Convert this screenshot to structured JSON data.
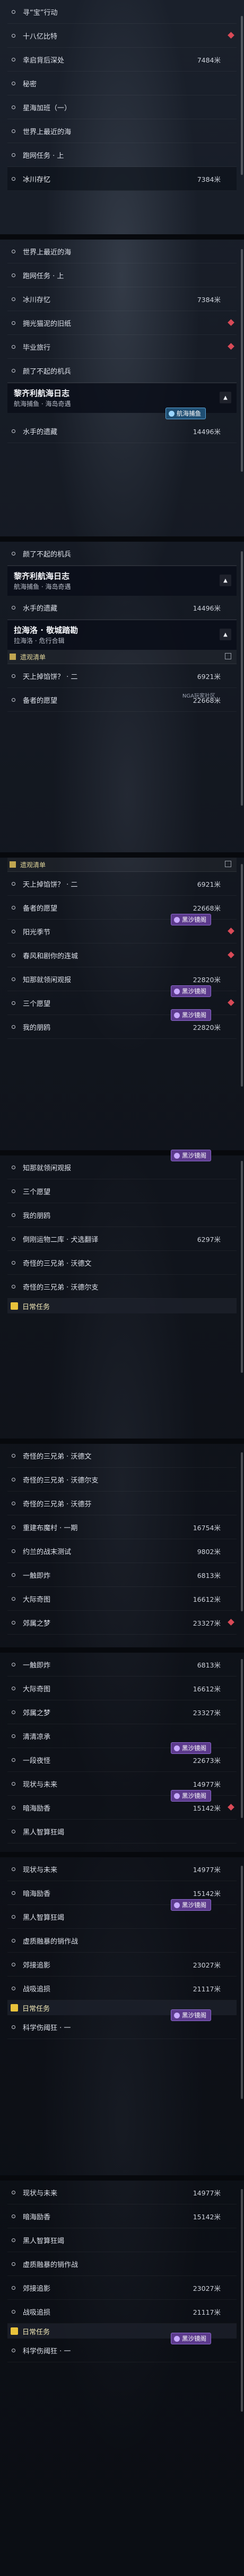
{
  "frame1": {
    "rows": [
      {
        "label": "寻“宝”行动",
        "dist": "",
        "pin": false
      },
      {
        "label": "十八亿比特",
        "dist": "",
        "pin": true
      },
      {
        "label": "幸启背后深处",
        "dist": "7484米",
        "pin": false
      },
      {
        "label": "秘密",
        "dist": "",
        "pin": false
      },
      {
        "label": "星海加班（一）",
        "dist": "",
        "pin": false
      },
      {
        "label": "世界上最近的海",
        "dist": "",
        "pin": false
      },
      {
        "label": "跑网任务 · 上",
        "dist": "",
        "pin": false
      },
      {
        "label": "冰川存忆",
        "dist": "7384米",
        "pin": false
      }
    ]
  },
  "frame2": {
    "rows": [
      {
        "label": "世界上最近的海",
        "dist": "",
        "pin": false
      },
      {
        "label": "跑网任务 · 上",
        "dist": "",
        "pin": false
      },
      {
        "label": "冰川存忆",
        "dist": "7384米",
        "pin": false
      },
      {
        "label": "拥光猫泥的旧纸",
        "dist": "",
        "pin": true
      },
      {
        "label": "毕业旅行",
        "dist": "",
        "pin": true
      },
      {
        "label": "颜了不起的机兵",
        "dist": "",
        "pin": false
      }
    ],
    "header": {
      "title": "黎齐利航海日志",
      "subtitle": "航海捕鱼 · 海岛奇遇"
    },
    "badge": "航海捕鱼",
    "after": [
      {
        "label": "水手的遗藏",
        "dist": "14496米"
      }
    ]
  },
  "frame3": {
    "rows": [
      {
        "label": "颜了不起的机兵",
        "dist": ""
      }
    ],
    "header1": {
      "title": "黎齐利航海日志",
      "subtitle": "航海捕鱼 · 海岛奇遇"
    },
    "after1": [
      {
        "label": "水手的遗藏",
        "dist": "14496米"
      }
    ],
    "header2": {
      "title": "拉海洛 · 敬城踏勘",
      "subtitle": "拉海洛 · 危行合辑"
    },
    "tag": "遗观清单",
    "after2": [
      {
        "label": "天上掉馅饼？ · 二",
        "dist": "6921米"
      },
      {
        "label": "备者的愿望",
        "dist": "22668米"
      }
    ],
    "watermark": "NGA玩家社区"
  },
  "frame4": {
    "tag": "遗观清单",
    "rows": [
      {
        "label": "天上掉馅饼？ · 二",
        "dist": "6921米",
        "pin": false,
        "badge": ""
      },
      {
        "label": "备者的愿望",
        "dist": "22668米",
        "pin": false,
        "badge": ""
      },
      {
        "label": "阳光季节",
        "dist": "",
        "pin": true,
        "badge": "黑沙镜阁"
      },
      {
        "label": "春风和剧你的连城",
        "dist": "",
        "pin": true,
        "badge": ""
      },
      {
        "label": "知那就领闲观报",
        "dist": "22820米",
        "pin": false,
        "badge": ""
      },
      {
        "label": "三个愿望",
        "dist": "",
        "pin": true,
        "badge": "黑沙镜阁"
      },
      {
        "label": "我的朋鸥",
        "dist": "22820米",
        "pin": false,
        "badge": "黑沙镜阁"
      }
    ]
  },
  "frame5": {
    "rows": [
      {
        "label": "知那就领闲观报",
        "dist": "",
        "pin": false,
        "badge": "黑沙镜阁"
      },
      {
        "label": "三个愿望",
        "dist": "",
        "pin": false,
        "badge": ""
      },
      {
        "label": "我的朋鸥",
        "dist": "",
        "pin": false,
        "badge": ""
      },
      {
        "label": "倒刚运物二库 · 犬选翻译",
        "dist": "6297米",
        "pin": false,
        "badge": ""
      },
      {
        "label": "奇怪的三兄弟 · 沃德文",
        "dist": "",
        "pin": false,
        "badge": ""
      },
      {
        "label": "奇怪的三兄弟 · 沃德尔支",
        "dist": "",
        "pin": false,
        "badge": ""
      }
    ],
    "tag": "日常任务"
  },
  "frame6": {
    "rows": [
      {
        "label": "奇怪的三兄弟 · 沃德文",
        "dist": "",
        "pin": false
      },
      {
        "label": "奇怪的三兄弟 · 沃德尔支",
        "dist": "",
        "pin": false
      },
      {
        "label": "奇怪的三兄弟 · 沃德芬",
        "dist": "",
        "pin": false
      },
      {
        "label": "重建布魔村 · 一期",
        "dist": "16754米",
        "pin": false
      },
      {
        "label": "约兰的战末测试",
        "dist": "9802米",
        "pin": false
      },
      {
        "label": "一触即炸",
        "dist": "6813米",
        "pin": false
      },
      {
        "label": "大际奇图",
        "dist": "16612米",
        "pin": false
      },
      {
        "label": "郊属之梦",
        "dist": "23327米",
        "pin": true
      }
    ]
  },
  "frame7": {
    "rows": [
      {
        "label": "一触即炸",
        "dist": "6813米",
        "pin": false,
        "badge": ""
      },
      {
        "label": "大际奇图",
        "dist": "16612米",
        "pin": false,
        "badge": ""
      },
      {
        "label": "郊属之梦",
        "dist": "23327米",
        "pin": false,
        "badge": ""
      },
      {
        "label": "清清凉承",
        "dist": "",
        "pin": false,
        "badge": ""
      },
      {
        "label": "一段夜怪",
        "dist": "22673米",
        "pin": false,
        "badge": "黑沙镜阁"
      },
      {
        "label": "现状与未来",
        "dist": "14977米",
        "pin": false,
        "badge": ""
      },
      {
        "label": "暗海励香",
        "dist": "15142米",
        "pin": true,
        "badge": "黑沙镜阁"
      },
      {
        "label": "黑人智算狂竭",
        "dist": "",
        "pin": false,
        "badge": ""
      }
    ]
  },
  "frame8": {
    "rows": [
      {
        "label": "现状与未来",
        "dist": "14977米",
        "pin": false,
        "badge": ""
      },
      {
        "label": "暗海励香",
        "dist": "15142米",
        "pin": false,
        "badge": ""
      },
      {
        "label": "黑人智算狂竭",
        "dist": "",
        "pin": false,
        "badge": "黑沙镜阁"
      },
      {
        "label": "虚质融暴的销作战",
        "dist": "",
        "pin": false,
        "badge": ""
      },
      {
        "label": "郊接追影",
        "dist": "23027米",
        "pin": false,
        "badge": ""
      },
      {
        "label": "战吸追损",
        "dist": "21117米",
        "pin": false,
        "badge": ""
      }
    ],
    "section": "日常任务",
    "after": [
      {
        "label": "科学伤阈狂 · 一",
        "dist": "",
        "badge": "黑沙镜阁"
      }
    ]
  },
  "frame9": {
    "rows": [
      {
        "label": "现状与未来",
        "dist": "14977米"
      },
      {
        "label": "暗海励香",
        "dist": "15142米"
      },
      {
        "label": "黑人智算狂竭",
        "dist": ""
      },
      {
        "label": "虚质融暴的销作战",
        "dist": ""
      },
      {
        "label": "郊接追影",
        "dist": "23027米"
      },
      {
        "label": "战吸追损",
        "dist": "21117米"
      }
    ],
    "section": "日常任务",
    "after": [
      {
        "label": "科学伤阈狂 · 一",
        "dist": "",
        "badge": "黑沙镜阁"
      }
    ]
  },
  "colors": {
    "pin": "#d94a57",
    "badge_purple": "#5c3a8c",
    "badge_blue": "#1f4e72",
    "section_yellow": "#e9c23b"
  }
}
